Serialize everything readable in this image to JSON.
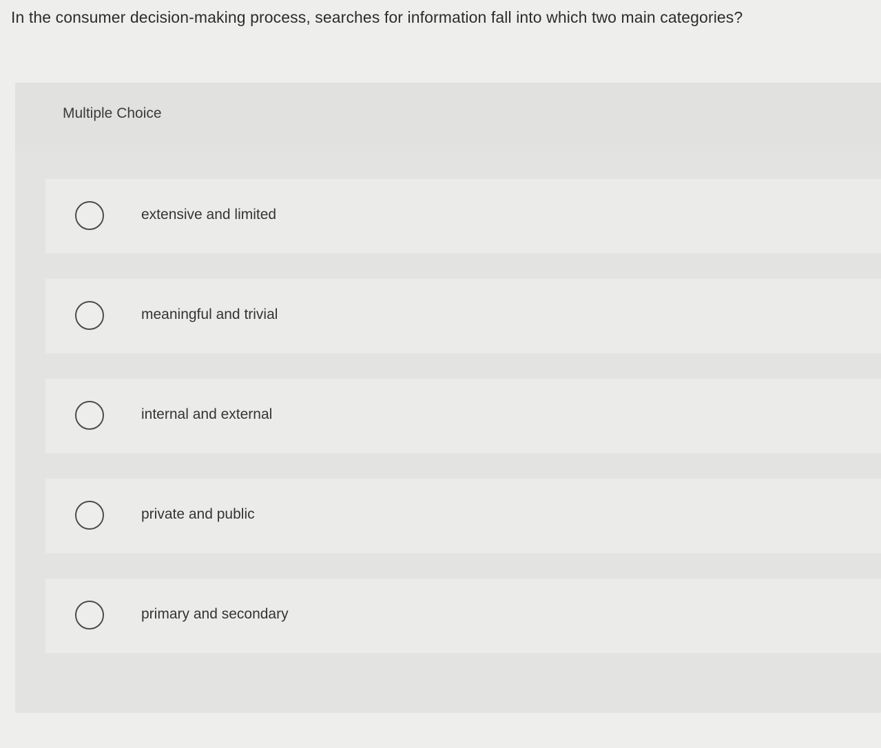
{
  "question": {
    "text": "In the consumer decision-making process, searches for information fall into which two main categories?"
  },
  "panel": {
    "title": "Multiple Choice"
  },
  "options": [
    {
      "label": "extensive and limited"
    },
    {
      "label": "meaningful and trivial"
    },
    {
      "label": "internal and external"
    },
    {
      "label": "private and public"
    },
    {
      "label": "primary and secondary"
    }
  ]
}
